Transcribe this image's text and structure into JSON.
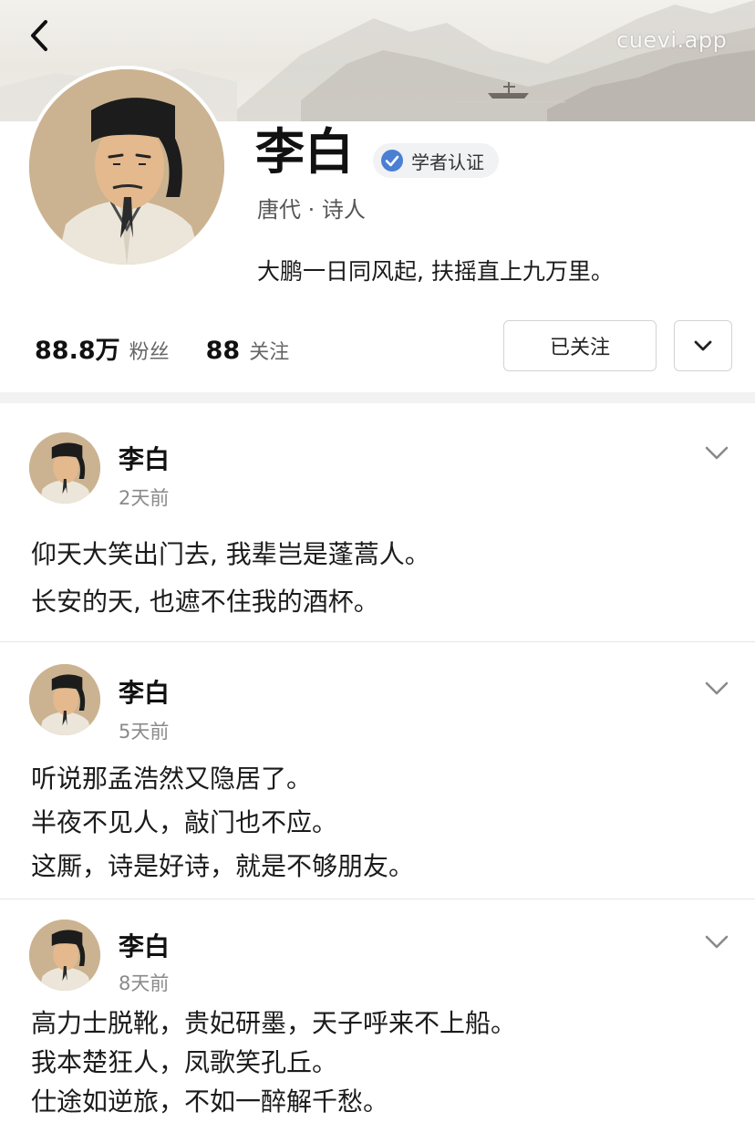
{
  "header": {
    "back_icon": "chevron-left-icon",
    "watermark": "cuevi.app"
  },
  "profile": {
    "name": "李白",
    "badge": "学者认证",
    "subtitle": "唐代 · 诗人",
    "bio": "大鹏一日同风起, 扶摇直上九万里。",
    "followers_count": "88.8万",
    "followers_label": "粉丝",
    "following_count": "88",
    "following_label": "关注",
    "follow_button": "已关注",
    "more_icon": "chevron-down-icon"
  },
  "posts": [
    {
      "author": "李白",
      "time": "2天前",
      "lines": [
        "仰天大笑出门去, 我辈岂是蓬蒿人。",
        "长安的天, 也遮不住我的酒杯。"
      ]
    },
    {
      "author": "李白",
      "time": "5天前",
      "lines": [
        "听说那孟浩然又隐居了。",
        "半夜不见人，敲门也不应。",
        "这厮，诗是好诗，就是不够朋友。"
      ]
    },
    {
      "author": "李白",
      "time": "8天前",
      "lines": [
        "高力士脱靴，贵妃研墨，天子呼来不上船。",
        "我本楚狂人，凤歌笑孔丘。",
        "仕途如逆旅，不如一醉解千愁。"
      ]
    }
  ],
  "colors": {
    "verified": "#4a7fd4",
    "divider": "#e6e6e6",
    "secondary_text": "#8a8a8a"
  }
}
